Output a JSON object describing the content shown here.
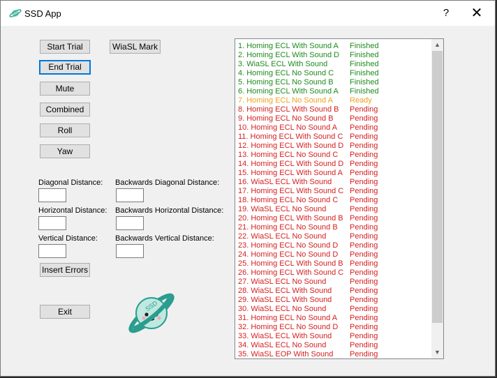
{
  "window": {
    "title": "SSD App",
    "help_label": "?",
    "close_label": "✕",
    "icon": "planet-icon"
  },
  "buttons": {
    "start_trial": "Start Trial",
    "wiasl_mark": "WiaSL Mark",
    "end_trial": "End Trial",
    "mute": "Mute",
    "combined": "Combined",
    "roll": "Roll",
    "yaw": "Yaw",
    "insert_errors": "Insert Errors",
    "exit": "Exit"
  },
  "distances": {
    "diagonal": "Diagonal Distance:",
    "backwards_diagonal": "Backwards Diagonal Distance:",
    "horizontal": "Horizontal Distance:",
    "backwards_horizontal": "Backwards Horizontal Distance:",
    "vertical": "Vertical Distance:",
    "backwards_vertical": "Backwards Vertical Distance:"
  },
  "logo": {
    "text": "SSD"
  },
  "colors": {
    "finished": "#1e8a1e",
    "ready": "#f0a020",
    "pending": "#d42020"
  },
  "trials": [
    {
      "name": "1.  Homing ECL With Sound A",
      "status": "Finished"
    },
    {
      "name": "2.  Homing ECL With Sound D",
      "status": "Finished"
    },
    {
      "name": "3.  WiaSL ECL With Sound",
      "status": "Finished"
    },
    {
      "name": "4.  Homing ECL No Sound C",
      "status": "Finished"
    },
    {
      "name": "5.  Homing ECL No Sound B",
      "status": "Finished"
    },
    {
      "name": "6.  Homing ECL With Sound A",
      "status": "Finished"
    },
    {
      "name": "7.  Homing ECL No Sound A",
      "status": "Ready"
    },
    {
      "name": "8.  Homing ECL With Sound B",
      "status": "Pending"
    },
    {
      "name": "9.  Homing ECL No Sound B",
      "status": "Pending"
    },
    {
      "name": "10.  Homing ECL No Sound A",
      "status": "Pending"
    },
    {
      "name": "11.  Homing ECL With Sound C",
      "status": "Pending"
    },
    {
      "name": "12.  Homing ECL With Sound D",
      "status": "Pending"
    },
    {
      "name": "13.  Homing ECL No Sound C",
      "status": "Pending"
    },
    {
      "name": "14.  Homing ECL With Sound D",
      "status": "Pending"
    },
    {
      "name": "15.  Homing ECL With Sound A",
      "status": "Pending"
    },
    {
      "name": "16.  WiaSL ECL With Sound",
      "status": "Pending"
    },
    {
      "name": "17.  Homing ECL With Sound C",
      "status": "Pending"
    },
    {
      "name": "18.  Homing ECL No Sound C",
      "status": "Pending"
    },
    {
      "name": "19.  WiaSL ECL No Sound",
      "status": "Pending"
    },
    {
      "name": "20.  Homing ECL With Sound B",
      "status": "Pending"
    },
    {
      "name": "21.  Homing ECL No Sound B",
      "status": "Pending"
    },
    {
      "name": "22.  WiaSL ECL No Sound",
      "status": "Pending"
    },
    {
      "name": "23.  Homing ECL No Sound D",
      "status": "Pending"
    },
    {
      "name": "24.  Homing ECL No Sound D",
      "status": "Pending"
    },
    {
      "name": "25.  Homing ECL With Sound B",
      "status": "Pending"
    },
    {
      "name": "26.  Homing ECL With Sound C",
      "status": "Pending"
    },
    {
      "name": "27.  WiaSL ECL No Sound",
      "status": "Pending"
    },
    {
      "name": "28.  WiaSL ECL With Sound",
      "status": "Pending"
    },
    {
      "name": "29.  WiaSL ECL With Sound",
      "status": "Pending"
    },
    {
      "name": "30.  WiaSL ECL No Sound",
      "status": "Pending"
    },
    {
      "name": "31.  Homing ECL No Sound A",
      "status": "Pending"
    },
    {
      "name": "32.  Homing ECL No Sound D",
      "status": "Pending"
    },
    {
      "name": "33.  WiaSL ECL With Sound",
      "status": "Pending"
    },
    {
      "name": "34.  WiaSL ECL No Sound",
      "status": "Pending"
    },
    {
      "name": "35.  WiaSL EOP With Sound",
      "status": "Pending"
    }
  ],
  "scroll": {
    "up": "▲",
    "down": "▼"
  }
}
